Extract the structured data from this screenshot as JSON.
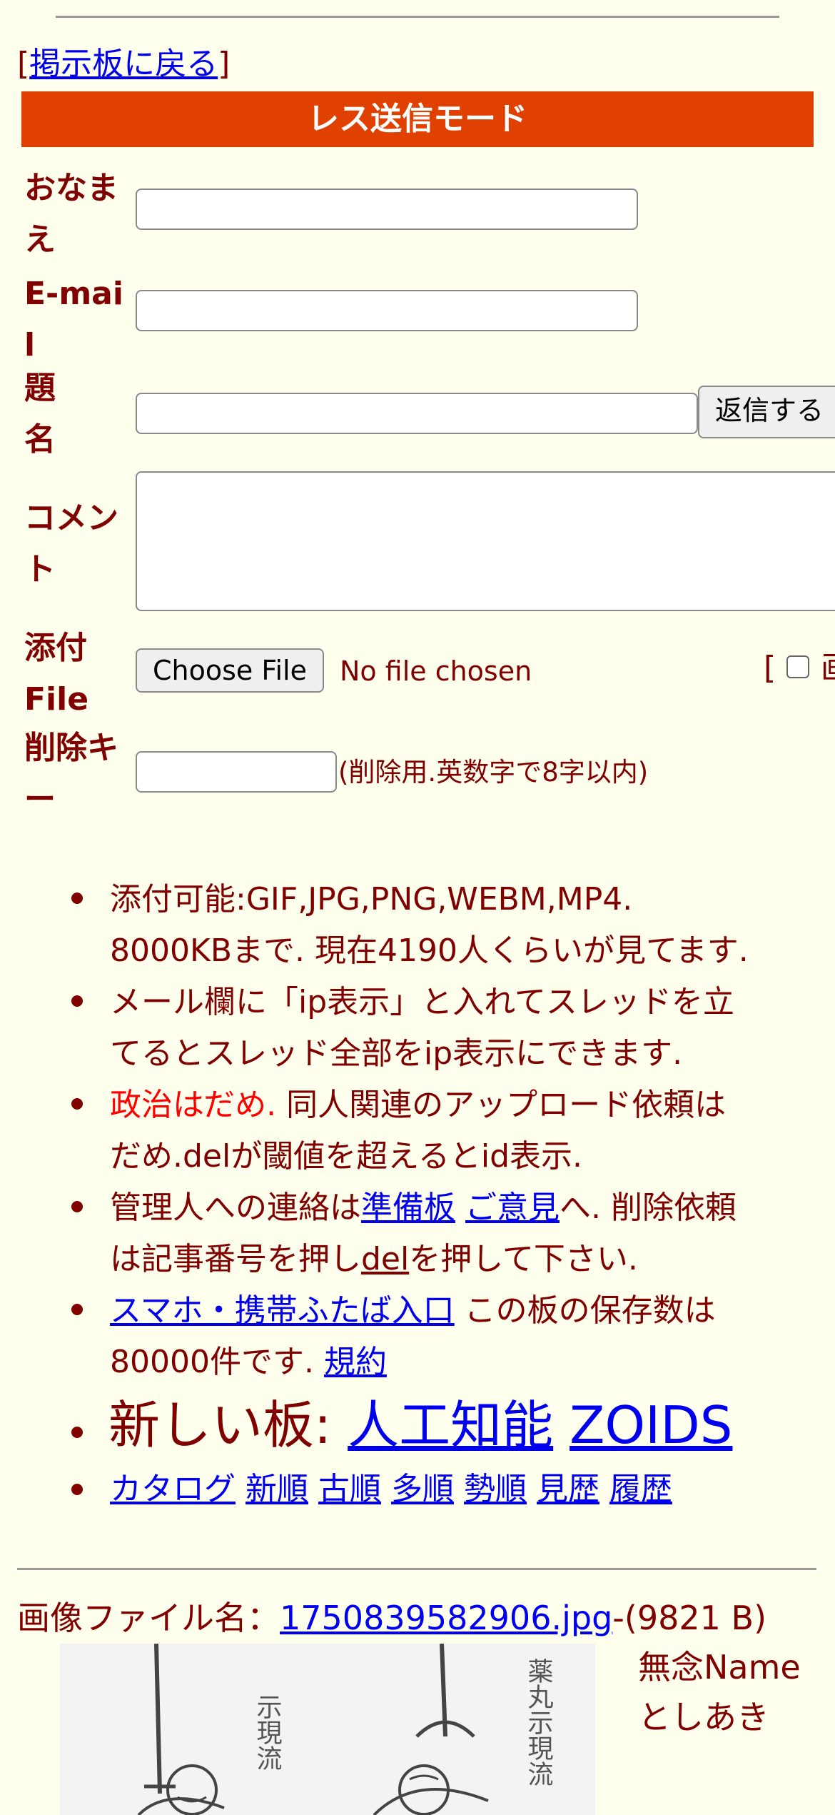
{
  "header": {
    "back_bracket_open": "[",
    "back_link": "掲示板に戻る",
    "back_bracket_close": "]",
    "mode_title": "レス送信モード"
  },
  "form": {
    "name_label": "おなまえ",
    "email_label": "E-mail",
    "subject_label": "題名",
    "submit_button": "返信する",
    "comment_label": "コメント",
    "attach_label": "添付File",
    "choose_file_button": "Choose File",
    "no_file_text": "No file chosen",
    "image_opt_prefix": "[",
    "image_opt_label": "画",
    "delete_key_label": "削除キー",
    "delete_key_hint": "(削除用.英数字で8字以内)"
  },
  "notes": {
    "n1_line1": "添付可能:GIF,JPG,PNG,WEBM,MP4.",
    "n1_line2": "8000KBまで. 現在4190人くらいが見てます.",
    "n2_line1": "メール欄に「ip表示」と入れてスレッドを立",
    "n2_line2": "てるとスレッド全部をip表示にできます.",
    "n3_red": "政治はだめ.",
    "n3_rest": " 同人関連のアップロード依頼は",
    "n3_line2": "だめ.delが閾値を超えるとid表示.",
    "n4_pre": "管理人への連絡は",
    "n4_link1": "準備板",
    "n4_link2": "ご意見",
    "n4_post": "へ. 削除依頼",
    "n4_line2_pre": "は記事番号を押し",
    "n4_del": "del",
    "n4_line2_post": "を押して下さい.",
    "n5_link": "スマホ・携帯ふたば入口",
    "n5_rest": " この板の保存数は",
    "n5_line2_pre": "80000件です. ",
    "n5_terms": "規約",
    "n6_prefix": "新しい板: ",
    "n6_link1": "人工知能",
    "n6_link2": "ZOIDS",
    "nav": [
      "カタログ",
      "新順",
      "古順",
      "多順",
      "勢順",
      "見歴",
      "履歴"
    ]
  },
  "post": {
    "file_label": "画像ファイル名：",
    "file_name": "1750839582906.jpg",
    "file_size": "-(9821 B)",
    "poster_line1": "無念Name",
    "poster_line2": "としあき",
    "thumb_text_left": "示現流",
    "thumb_text_right": "薬丸示現流"
  }
}
